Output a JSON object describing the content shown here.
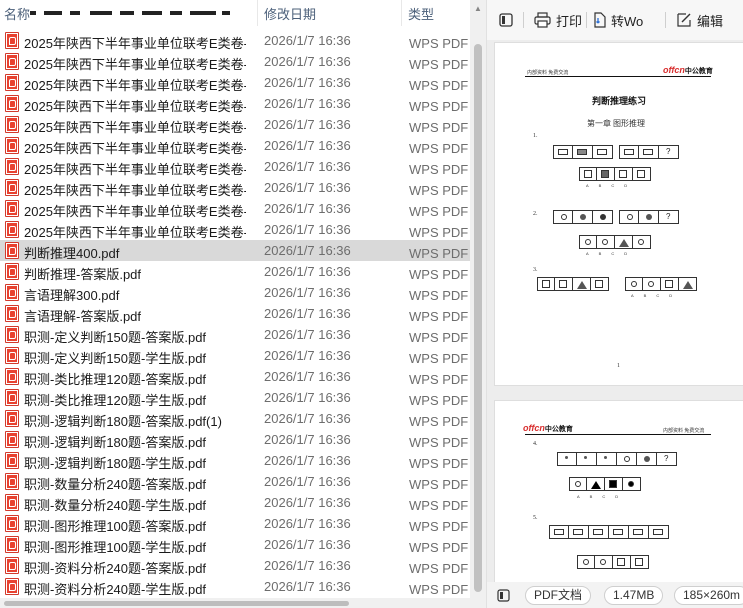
{
  "columns": {
    "name": "名称",
    "date": "修改日期",
    "type": "类型"
  },
  "files": [
    {
      "name": "2025年陕西下半年事业单位联考E类卷-...",
      "date": "2026/1/7 16:36",
      "type": "WPS PDF 文"
    },
    {
      "name": "2025年陕西下半年事业单位联考E类卷-...",
      "date": "2026/1/7 16:36",
      "type": "WPS PDF 文"
    },
    {
      "name": "2025年陕西下半年事业单位联考E类卷-...",
      "date": "2026/1/7 16:36",
      "type": "WPS PDF 文"
    },
    {
      "name": "2025年陕西下半年事业单位联考E类卷-...",
      "date": "2026/1/7 16:36",
      "type": "WPS PDF 文"
    },
    {
      "name": "2025年陕西下半年事业单位联考E类卷-...",
      "date": "2026/1/7 16:36",
      "type": "WPS PDF 文"
    },
    {
      "name": "2025年陕西下半年事业单位联考E类卷-...",
      "date": "2026/1/7 16:36",
      "type": "WPS PDF 文"
    },
    {
      "name": "2025年陕西下半年事业单位联考E类卷-...",
      "date": "2026/1/7 16:36",
      "type": "WPS PDF 文"
    },
    {
      "name": "2025年陕西下半年事业单位联考E类卷-...",
      "date": "2026/1/7 16:36",
      "type": "WPS PDF 文"
    },
    {
      "name": "2025年陕西下半年事业单位联考E类卷-...",
      "date": "2026/1/7 16:36",
      "type": "WPS PDF 文"
    },
    {
      "name": "2025年陕西下半年事业单位联考E类卷-...",
      "date": "2026/1/7 16:36",
      "type": "WPS PDF 文"
    },
    {
      "name": "判断推理400.pdf",
      "date": "2026/1/7 16:36",
      "type": "WPS PDF 文",
      "selected": true
    },
    {
      "name": "判断推理-答案版.pdf",
      "date": "2026/1/7 16:36",
      "type": "WPS PDF 文"
    },
    {
      "name": "言语理解300.pdf",
      "date": "2026/1/7 16:36",
      "type": "WPS PDF 文"
    },
    {
      "name": "言语理解-答案版.pdf",
      "date": "2026/1/7 16:36",
      "type": "WPS PDF 文"
    },
    {
      "name": "职测-定义判断150题-答案版.pdf",
      "date": "2026/1/7 16:36",
      "type": "WPS PDF 文"
    },
    {
      "name": "职测-定义判断150题-学生版.pdf",
      "date": "2026/1/7 16:36",
      "type": "WPS PDF 文"
    },
    {
      "name": "职测-类比推理120题-答案版.pdf",
      "date": "2026/1/7 16:36",
      "type": "WPS PDF 文"
    },
    {
      "name": "职测-类比推理120题-学生版.pdf",
      "date": "2026/1/7 16:36",
      "type": "WPS PDF 文"
    },
    {
      "name": "职测-逻辑判断180题-答案版.pdf(1)",
      "date": "2026/1/7 16:36",
      "type": "WPS PDF 文"
    },
    {
      "name": "职测-逻辑判断180题-答案版.pdf",
      "date": "2026/1/7 16:36",
      "type": "WPS PDF 文"
    },
    {
      "name": "职测-逻辑判断180题-学生版.pdf",
      "date": "2026/1/7 16:36",
      "type": "WPS PDF 文"
    },
    {
      "name": "职测-数量分析240题-答案版.pdf",
      "date": "2026/1/7 16:36",
      "type": "WPS PDF 文"
    },
    {
      "name": "职测-数量分析240题-学生版.pdf",
      "date": "2026/1/7 16:36",
      "type": "WPS PDF 文"
    },
    {
      "name": "职测-图形推理100题-答案版.pdf",
      "date": "2026/1/7 16:36",
      "type": "WPS PDF 文"
    },
    {
      "name": "职测-图形推理100题-学生版.pdf",
      "date": "2026/1/7 16:36",
      "type": "WPS PDF 文"
    },
    {
      "name": "职测-资料分析240题-答案版.pdf",
      "date": "2026/1/7 16:36",
      "type": "WPS PDF 文"
    },
    {
      "name": "职测-资料分析240题-学生版.pdf",
      "date": "2026/1/7 16:36",
      "type": "WPS PDF 文"
    }
  ],
  "preview": {
    "toolbar": {
      "print": "打印",
      "convert": "转Wo",
      "edit": "编辑"
    },
    "page1": {
      "header_left": "内部资料 免费交流",
      "logo": "offcn",
      "logo_cn": "中公教育",
      "title": "判断推理练习",
      "chapter": "第一章  图形推理",
      "q1": "1.",
      "q2": "2.",
      "q3": "3.",
      "options": "ABCD",
      "page_no": "1"
    },
    "page2": {
      "logo": "offcn",
      "logo_cn": "中公教育",
      "header_right": "内部资料 免费交流",
      "q4": "4.",
      "q5": "5."
    },
    "status": {
      "file_type": "PDF文档",
      "size": "1.47MB",
      "dims": "185×260m"
    }
  },
  "colors": {
    "selection": "#d9d9d9",
    "pdf_icon": "#e8412f",
    "header_text": "#4c607a"
  }
}
